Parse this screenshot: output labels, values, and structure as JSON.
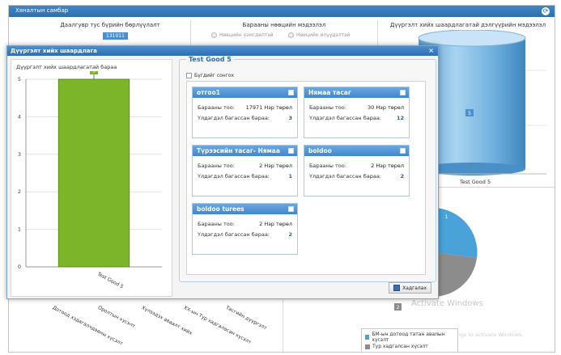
{
  "dashboard": {
    "title": "Хянaлтын самбар",
    "panels": {
      "left": "Даалгувр тус бүрийн бөрлүүлалт",
      "middle": "Барааны нөөцийн мэдээлэл",
      "right": "Дүүргэлт хийх шаардлагатай дэлгүүрийн мэдээлэл"
    },
    "left_badge": "131011",
    "radio_1": "Нөөцийн хэмсдөлтэй",
    "radio_2": "Нөөцийн илүүдэлтэй",
    "cylinder_label": "Test Good 5",
    "cylinder_value": "5",
    "pie_label_1": "1",
    "pie_label_2": "2",
    "bottom_x_labels": [
      "Дотоод хэдагалчдааны хүсэлт",
      "Оролтын хүсэлт",
      "Хүлээдэх аваалт хийх",
      "ХХ-ын Тур хадгаласан хүсэлт",
      "Тасгийн дүүргэлт"
    ],
    "legend": [
      {
        "label": "БМ-ын дотоод татан авалын хүсэлт",
        "color": "#4aa3d8"
      },
      {
        "label": "Тур хадгалсан хүсэлт",
        "color": "#8c8c8c"
      }
    ],
    "watermark_title": "Activate Windows",
    "watermark_sub": "Go to Settings to activate Windows."
  },
  "modal": {
    "title": "Дүүргэлт хийх шаардлага",
    "close": "×",
    "chart_title": "Дүүргэлт хийх шаардлагатай бараа",
    "product_title": "Test Good 5",
    "select_all": "Бүгдийг сонгох",
    "save": "Хадгалах",
    "cards": [
      {
        "name": "отгоо1",
        "qty_label": "Барааны тоо:",
        "qty": "17971 Нэр төрөл",
        "rem_label": "Үлдэгдэл багассан бараа:",
        "rem": "3"
      },
      {
        "name": "Нямаа тасаг",
        "qty_label": "Барааны тоо:",
        "qty": "30 Нэр төрөл",
        "rem_label": "Үлдэгдэл багассан бараа:",
        "rem": "12"
      },
      {
        "name": "Түрээсийн тасаг- Нямаа",
        "qty_label": "Барааны тоо:",
        "qty": "2 Нэр төрөл",
        "rem_label": "Үлдэгдэл багассан бараа:",
        "rem": "1"
      },
      {
        "name": "boldoo",
        "qty_label": "Барааны тоо:",
        "qty": "2 Нэр төрөл",
        "rem_label": "Үлдэгдэл багассан бараа:",
        "rem": "2"
      },
      {
        "name": "boldoo turees",
        "qty_label": "Барааны тоо:",
        "qty": "2 Нэр төрөл",
        "rem_label": "Үлдэгдэл багассан бараа:",
        "rem": "2"
      }
    ]
  },
  "chart_data": {
    "type": "bar",
    "categories": [
      "Test Good 5"
    ],
    "values": [
      5
    ],
    "title": "Дүүргэлт хийх шаардлагатай бараа",
    "ylim": [
      0,
      5
    ],
    "yticks": [
      0,
      1,
      2,
      3,
      4,
      5
    ],
    "bar_color": "#7cb52a",
    "grid": true
  }
}
